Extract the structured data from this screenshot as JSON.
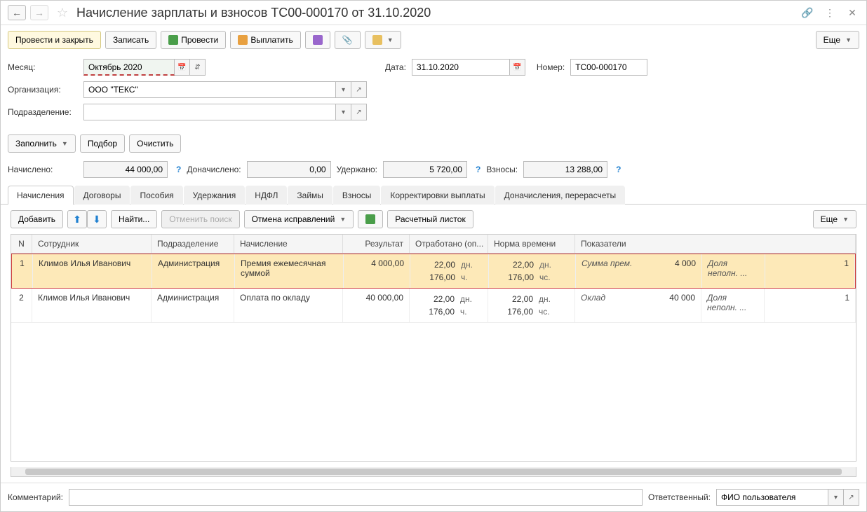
{
  "header": {
    "title": "Начисление зарплаты и взносов ТС00-000170 от 31.10.2020"
  },
  "toolbar": {
    "post_close": "Провести и закрыть",
    "save": "Записать",
    "post": "Провести",
    "pay": "Выплатить",
    "more": "Еще"
  },
  "fields": {
    "month_label": "Месяц:",
    "month_value": "Октябрь 2020",
    "date_label": "Дата:",
    "date_value": "31.10.2020",
    "number_label": "Номер:",
    "number_value": "ТС00-000170",
    "org_label": "Организация:",
    "org_value": "ООО \"ТЕКС\"",
    "dept_label": "Подразделение:",
    "dept_value": ""
  },
  "actions": {
    "fill": "Заполнить",
    "select": "Подбор",
    "clear": "Очистить"
  },
  "totals": {
    "accrued_label": "Начислено:",
    "accrued": "44 000,00",
    "extra_label": "Доначислено:",
    "extra": "0,00",
    "withheld_label": "Удержано:",
    "withheld": "5 720,00",
    "contrib_label": "Взносы:",
    "contrib": "13 288,00"
  },
  "tabs": [
    {
      "label": "Начисления"
    },
    {
      "label": "Договоры"
    },
    {
      "label": "Пособия"
    },
    {
      "label": "Удержания"
    },
    {
      "label": "НДФЛ"
    },
    {
      "label": "Займы"
    },
    {
      "label": "Взносы"
    },
    {
      "label": "Корректировки выплаты"
    },
    {
      "label": "Доначисления, перерасчеты"
    }
  ],
  "sub_toolbar": {
    "add": "Добавить",
    "find": "Найти...",
    "cancel_find": "Отменить поиск",
    "cancel_corr": "Отмена исправлений",
    "payslip": "Расчетный листок",
    "more": "Еще"
  },
  "table": {
    "headers": {
      "n": "N",
      "emp": "Сотрудник",
      "dep": "Подразделение",
      "calc": "Начисление",
      "res": "Результат",
      "worked": "Отработано (оп...",
      "norm": "Норма времени",
      "ind": "Показатели"
    },
    "rows": [
      {
        "n": "1",
        "emp": "Климов Илья Иванович",
        "dep": "Администрация",
        "calc": "Премия ежемесячная суммой",
        "res": "4 000,00",
        "worked_days": "22,00",
        "worked_days_u": "дн.",
        "worked_hours": "176,00",
        "worked_hours_u": "ч.",
        "norm_days": "22,00",
        "norm_days_u": "дн.",
        "norm_hours": "176,00",
        "norm_hours_u": "чс.",
        "ind_name": "Сумма прем.",
        "ind_val": "4 000",
        "extra": "Доля неполн. ...",
        "end": "1"
      },
      {
        "n": "2",
        "emp": "Климов Илья Иванович",
        "dep": "Администрация",
        "calc": "Оплата по окладу",
        "res": "40 000,00",
        "worked_days": "22,00",
        "worked_days_u": "дн.",
        "worked_hours": "176,00",
        "worked_hours_u": "ч.",
        "norm_days": "22,00",
        "norm_days_u": "дн.",
        "norm_hours": "176,00",
        "norm_hours_u": "чс.",
        "ind_name": "Оклад",
        "ind_val": "40 000",
        "extra": "Доля неполн. ...",
        "end": "1"
      }
    ]
  },
  "footer": {
    "comment_label": "Комментарий:",
    "comment_value": "",
    "resp_label": "Ответственный:",
    "resp_value": "ФИО пользователя"
  }
}
